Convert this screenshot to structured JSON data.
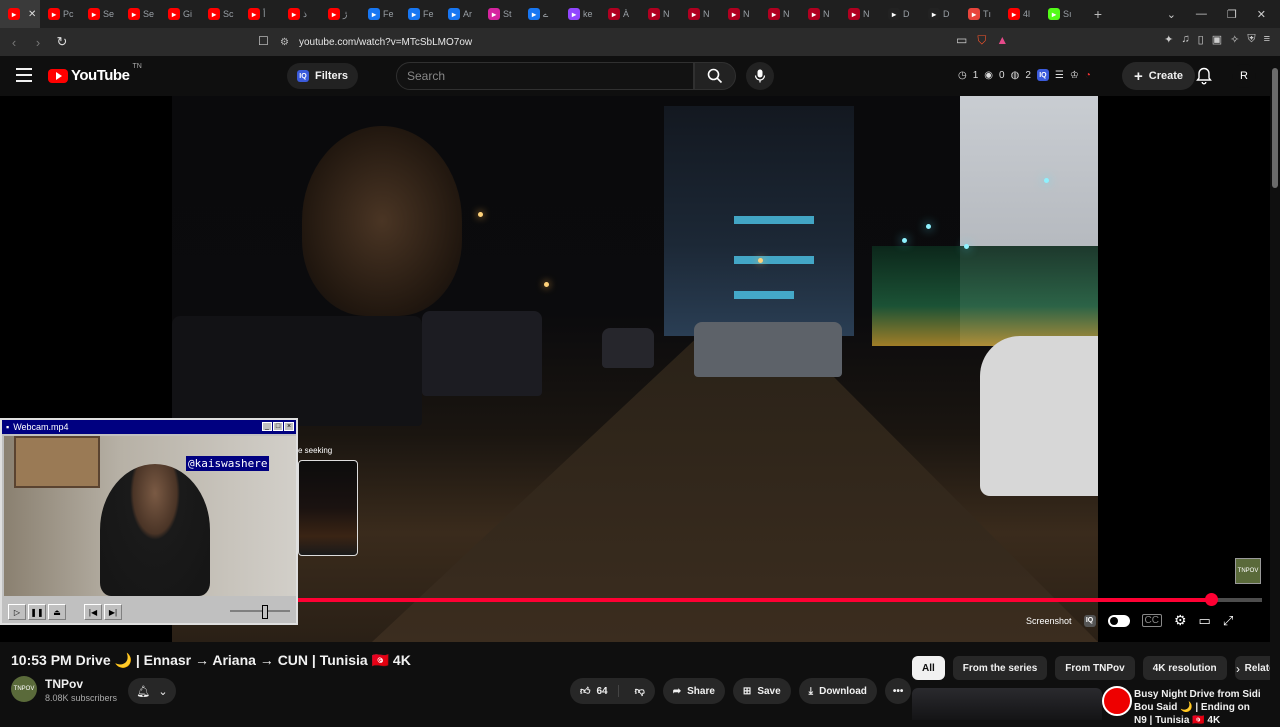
{
  "browser": {
    "tabs": [
      {
        "icon": "youtube-icon",
        "label": "",
        "color": "#ff0000"
      },
      {
        "icon": "youtube-icon",
        "label": "Pc",
        "color": "#ff0000"
      },
      {
        "icon": "youtube-icon",
        "label": "Se",
        "color": "#ff0000"
      },
      {
        "icon": "youtube-icon",
        "label": "Se",
        "color": "#ff0000"
      },
      {
        "icon": "youtube-icon",
        "label": "Gi",
        "color": "#ff0000"
      },
      {
        "icon": "youtube-icon",
        "label": "Sc",
        "color": "#ff0000"
      },
      {
        "icon": "youtube-icon",
        "label": "أ",
        "color": "#ff0000"
      },
      {
        "icon": "youtube-icon",
        "label": "ذ",
        "color": "#ff0000"
      },
      {
        "icon": "youtube-icon",
        "label": "ڙ",
        "color": "#ff0000"
      },
      {
        "icon": "facebook-icon",
        "label": "Fe",
        "color": "#1877f2"
      },
      {
        "icon": "facebook-icon",
        "label": "Fe",
        "color": "#1877f2"
      },
      {
        "icon": "facebook-icon",
        "label": "Ar",
        "color": "#1877f2"
      },
      {
        "icon": "instagram-icon",
        "label": "St",
        "color": "#d6249f"
      },
      {
        "icon": "facebook-icon",
        "label": "ے",
        "color": "#1877f2"
      },
      {
        "icon": "twitch-icon",
        "label": "ke",
        "color": "#9146ff"
      },
      {
        "icon": "news-icon",
        "label": "À",
        "color": "#b00020"
      },
      {
        "icon": "news-icon",
        "label": "N",
        "color": "#b00020"
      },
      {
        "icon": "news-icon",
        "label": "N",
        "color": "#b00020"
      },
      {
        "icon": "news-icon",
        "label": "N",
        "color": "#b00020"
      },
      {
        "icon": "news-icon",
        "label": "N",
        "color": "#b00020"
      },
      {
        "icon": "news-icon",
        "label": "N",
        "color": "#b00020"
      },
      {
        "icon": "news-icon",
        "label": "N",
        "color": "#b00020"
      },
      {
        "icon": "x-icon",
        "label": "D",
        "color": "#222222"
      },
      {
        "icon": "x-icon",
        "label": "D",
        "color": "#222222"
      },
      {
        "icon": "app-icon",
        "label": "Tı",
        "color": "#e8453c"
      },
      {
        "icon": "youtube-icon",
        "label": "4l",
        "color": "#ff0000"
      },
      {
        "icon": "kick-icon",
        "label": "Sı",
        "color": "#53fc18"
      }
    ],
    "url": "youtube.com/watch?v=MTcSbLMO7ow"
  },
  "header": {
    "logo_text": "YouTube",
    "logo_region": "TN",
    "filters_label": "Filters",
    "search_placeholder": "Search",
    "stats": [
      "1",
      "0",
      "2"
    ],
    "create_label": "Create",
    "avatar_letter": "R"
  },
  "player": {
    "preview_label": "e seeking",
    "progress": 0.947,
    "screenshot_label": "Screenshot",
    "channel_watermark": "TNPOV"
  },
  "webcam": {
    "title": "Webcam.mp4",
    "handle": "@kaiswashere"
  },
  "video": {
    "title": "10:53 PM Drive 🌙 | Ennasr → Ariana → CUN | Tunisia 🇹🇳 4K",
    "channel": "TNPov",
    "subscribers": "8.08K subscribers",
    "likes": "64",
    "share_label": "Share",
    "save_label": "Save",
    "download_label": "Download"
  },
  "chips": [
    "All",
    "From the series",
    "From TNPov",
    "4K resolution",
    "Related"
  ],
  "recommendation": {
    "title": "Busy Night Drive from Sidi Bou Said 🌙 | Ending on N9 | Tunisia 🇹🇳 4K"
  }
}
